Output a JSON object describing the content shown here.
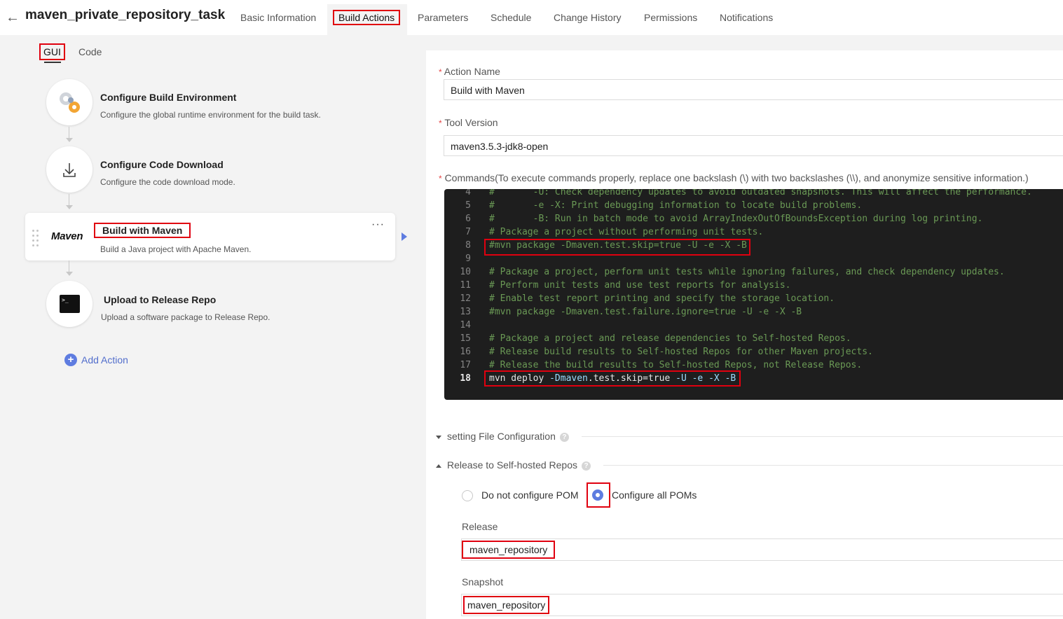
{
  "header": {
    "back_label": "←",
    "title": "maven_private_repository_task",
    "tabs": [
      {
        "label": "Basic Information"
      },
      {
        "label": "Build Actions"
      },
      {
        "label": "Parameters"
      },
      {
        "label": "Schedule"
      },
      {
        "label": "Change History"
      },
      {
        "label": "Permissions"
      },
      {
        "label": "Notifications"
      }
    ],
    "active_tab": "Build Actions"
  },
  "mode_tabs": {
    "gui": "GUI",
    "code": "Code",
    "active": "GUI"
  },
  "steps": [
    {
      "title": "Configure Build Environment",
      "desc": "Configure the global runtime environment for the build task.",
      "icon": "gears-icon"
    },
    {
      "title": "Configure Code Download",
      "desc": "Configure the code download mode.",
      "icon": "download-icon"
    },
    {
      "title": "Build with Maven",
      "desc": "Build a Java project with Apache Maven.",
      "icon": "maven-logo",
      "logo_text": "Maven",
      "selected": true
    },
    {
      "title": "Upload to Release Repo",
      "desc": "Upload a software package to Release Repo.",
      "icon": "terminal-icon",
      "terminal_text": ">_"
    }
  ],
  "more_label": "···",
  "add_action": {
    "icon": "+",
    "label": "Add Action"
  },
  "form": {
    "action_name": {
      "label": "Action Name",
      "value": "Build with Maven",
      "required": "*"
    },
    "tool_version": {
      "label": "Tool Version",
      "value": "maven3.5.3-jdk8-open",
      "required": "*"
    },
    "commands": {
      "label": "Commands(To execute commands properly, replace one backslash (\\) with two backslashes (\\\\), and anonymize sensitive information.)",
      "required": "*"
    }
  },
  "code_lines": [
    {
      "n": "4",
      "text": "#       -U: Check dependency updates to avoid outdated snapshots. This will affect the performance."
    },
    {
      "n": "5",
      "text": "#       -e -X: Print debugging information to locate build problems."
    },
    {
      "n": "6",
      "text": "#       -B: Run in batch mode to avoid ArrayIndexOutOfBoundsException during log printing."
    },
    {
      "n": "7",
      "text": "# Package a project without performing unit tests."
    },
    {
      "n": "8",
      "text": "#mvn package -Dmaven.test.skip=true -U -e -X -B"
    },
    {
      "n": "9",
      "text": ""
    },
    {
      "n": "10",
      "text": "# Package a project, perform unit tests while ignoring failures, and check dependency updates."
    },
    {
      "n": "11",
      "text": "# Perform unit tests and use test reports for analysis."
    },
    {
      "n": "12",
      "text": "# Enable test report printing and specify the storage location."
    },
    {
      "n": "13",
      "text": "#mvn package -Dmaven.test.failure.ignore=true -U -e -X -B"
    },
    {
      "n": "14",
      "text": ""
    },
    {
      "n": "15",
      "text": "# Package a project and release dependencies to Self-hosted Repos."
    },
    {
      "n": "16",
      "text": "# Release build results to Self-hosted Repos for other Maven projects."
    },
    {
      "n": "17",
      "text": "# Release the build results to Self-hosted Repos, not Release Repos."
    }
  ],
  "code_last": {
    "n": "18",
    "cmd": "mvn deploy ",
    "flag1": "-Dmaven",
    "mid": ".test.skip=",
    "val": "true ",
    "flag2": "-U -e -X -B"
  },
  "sections": {
    "settings": {
      "label": "setting File Configuration",
      "help": "?",
      "expanded": false
    },
    "release": {
      "label": "Release to Self-hosted Repos",
      "help": "?",
      "expanded": true
    }
  },
  "pom": {
    "options": [
      "Do not configure POM",
      "Configure all POMs"
    ],
    "selected": "Configure all POMs"
  },
  "release": {
    "label": "Release",
    "value": "maven_repository"
  },
  "snapshot": {
    "label": "Snapshot",
    "value": "maven_repository"
  },
  "colors": {
    "accent": "#5e7ce0",
    "highlight": "#e0000f",
    "editor_bg": "#1e1e1e",
    "comment": "#6a9955"
  }
}
